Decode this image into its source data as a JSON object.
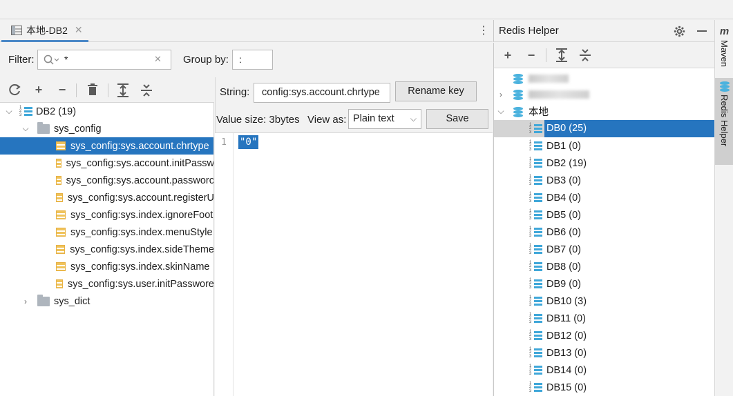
{
  "editor_tab": {
    "label": "本地-DB2",
    "close": "✕"
  },
  "filter": {
    "label": "Filter:",
    "value": "*",
    "clear": "✕",
    "group_label": "Group by:",
    "group_value": ":"
  },
  "left_toolbar": [
    "refresh-icon",
    "add-icon",
    "remove-icon",
    "delete-icon",
    "expand-all-icon",
    "collapse-all-icon"
  ],
  "key_tree": {
    "db": {
      "label": "DB2 (19)",
      "icon_digits": "1\n2\n3"
    },
    "groups": [
      {
        "label": "sys_config",
        "expanded": true,
        "keys": [
          "sys_config:sys.account.chrtype",
          "sys_config:sys.account.initPassw",
          "sys_config:sys.account.passworc",
          "sys_config:sys.account.registerU",
          "sys_config:sys.index.ignoreFoot",
          "sys_config:sys.index.menuStyle",
          "sys_config:sys.index.sideTheme",
          "sys_config:sys.index.skinName",
          "sys_config:sys.user.initPasswore"
        ],
        "selected_index": 0
      },
      {
        "label": "sys_dict",
        "expanded": false
      }
    ]
  },
  "value_panel": {
    "string_label": "String:",
    "key_value": "config:sys.account.chrtype",
    "rename_label": "Rename key",
    "size_label": "Value size: 3bytes",
    "view_as_label": "View as:",
    "view_as_value": "Plain text",
    "save_label": "Save",
    "line_number": "1",
    "value": "\"0\""
  },
  "redis_helper": {
    "title": "Redis Helper",
    "connection_label": "本地",
    "databases": [
      "DB0 (25)",
      "DB1 (0)",
      "DB2 (19)",
      "DB3 (0)",
      "DB4 (0)",
      "DB5 (0)",
      "DB6 (0)",
      "DB7 (0)",
      "DB8 (0)",
      "DB9 (0)",
      "DB10 (3)",
      "DB11 (0)",
      "DB12 (0)",
      "DB13 (0)",
      "DB14 (0)",
      "DB15 (0)"
    ],
    "selected_index": 0
  },
  "side_strip": {
    "maven_icon": "m",
    "maven_label": "Maven",
    "redis_label": "Redis Helper"
  },
  "colors": {
    "accent": "#2675bf",
    "db_icon": "#3fa7d9",
    "key_icon": "#f0c35a"
  }
}
